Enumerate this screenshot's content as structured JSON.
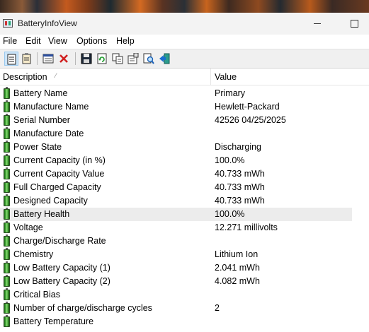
{
  "window": {
    "title": "BatteryInfoView"
  },
  "menu": [
    "File",
    "Edit",
    "View",
    "Options",
    "Help"
  ],
  "toolbar": {
    "buttons": [
      "battery-info-mode-icon",
      "log-mode-icon",
      "properties-window-icon",
      "delete-icon",
      "save-icon",
      "refresh-icon",
      "copy-icon",
      "properties-icon",
      "find-icon",
      "exit-icon"
    ]
  },
  "columns": {
    "description": "Description",
    "value": "Value"
  },
  "rows": [
    {
      "description": "Battery Name",
      "value": "Primary"
    },
    {
      "description": "Manufacture Name",
      "value": "Hewlett-Packard"
    },
    {
      "description": "Serial Number",
      "value": "42526 04/25/2025"
    },
    {
      "description": "Manufacture Date",
      "value": ""
    },
    {
      "description": "Power State",
      "value": "Discharging"
    },
    {
      "description": "Current Capacity (in %)",
      "value": "100.0%"
    },
    {
      "description": "Current Capacity Value",
      "value": "40.733 mWh"
    },
    {
      "description": "Full Charged Capacity",
      "value": "40.733 mWh"
    },
    {
      "description": "Designed Capacity",
      "value": "40.733 mWh"
    },
    {
      "description": "Battery Health",
      "value": "100.0%"
    },
    {
      "description": "Voltage",
      "value": "12.271 millivolts"
    },
    {
      "description": "Charge/Discharge Rate",
      "value": ""
    },
    {
      "description": "Chemistry",
      "value": "Lithium Ion"
    },
    {
      "description": "Low Battery Capacity (1)",
      "value": "2.041 mWh"
    },
    {
      "description": "Low Battery Capacity (2)",
      "value": "4.082 mWh"
    },
    {
      "description": "Critical Bias",
      "value": ""
    },
    {
      "description": "Number of charge/discharge cycles",
      "value": "2"
    },
    {
      "description": "Battery Temperature",
      "value": ""
    }
  ],
  "selected_row": "Battery Health"
}
